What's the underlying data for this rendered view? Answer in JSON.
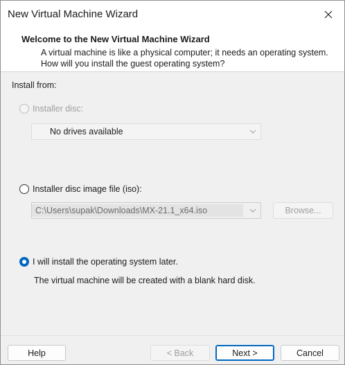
{
  "window": {
    "title": "New Virtual Machine Wizard"
  },
  "header": {
    "title": "Welcome to the New Virtual Machine Wizard",
    "description": "A virtual machine is like a physical computer; it needs an operating system. How will you install the guest operating system?"
  },
  "install_from": {
    "label": "Install from:",
    "options": [
      {
        "label": "Installer disc:",
        "enabled": false,
        "selected": false
      },
      {
        "label": "Installer disc image file (iso):",
        "enabled": true,
        "selected": false
      },
      {
        "label": "I will install the operating system later.",
        "enabled": true,
        "selected": true
      }
    ],
    "disc_dropdown": {
      "value": "No drives available"
    },
    "iso_dropdown": {
      "value": "C:\\Users\\supak\\Downloads\\MX-21.1_x64.iso"
    },
    "browse_label": "Browse...",
    "later_note": "The virtual machine will be created with a blank hard disk."
  },
  "footer": {
    "help": "Help",
    "back": "< Back",
    "next": "Next >",
    "cancel": "Cancel"
  },
  "colors": {
    "accent": "#0067c0",
    "dialog_bg": "#f0f0f0"
  }
}
